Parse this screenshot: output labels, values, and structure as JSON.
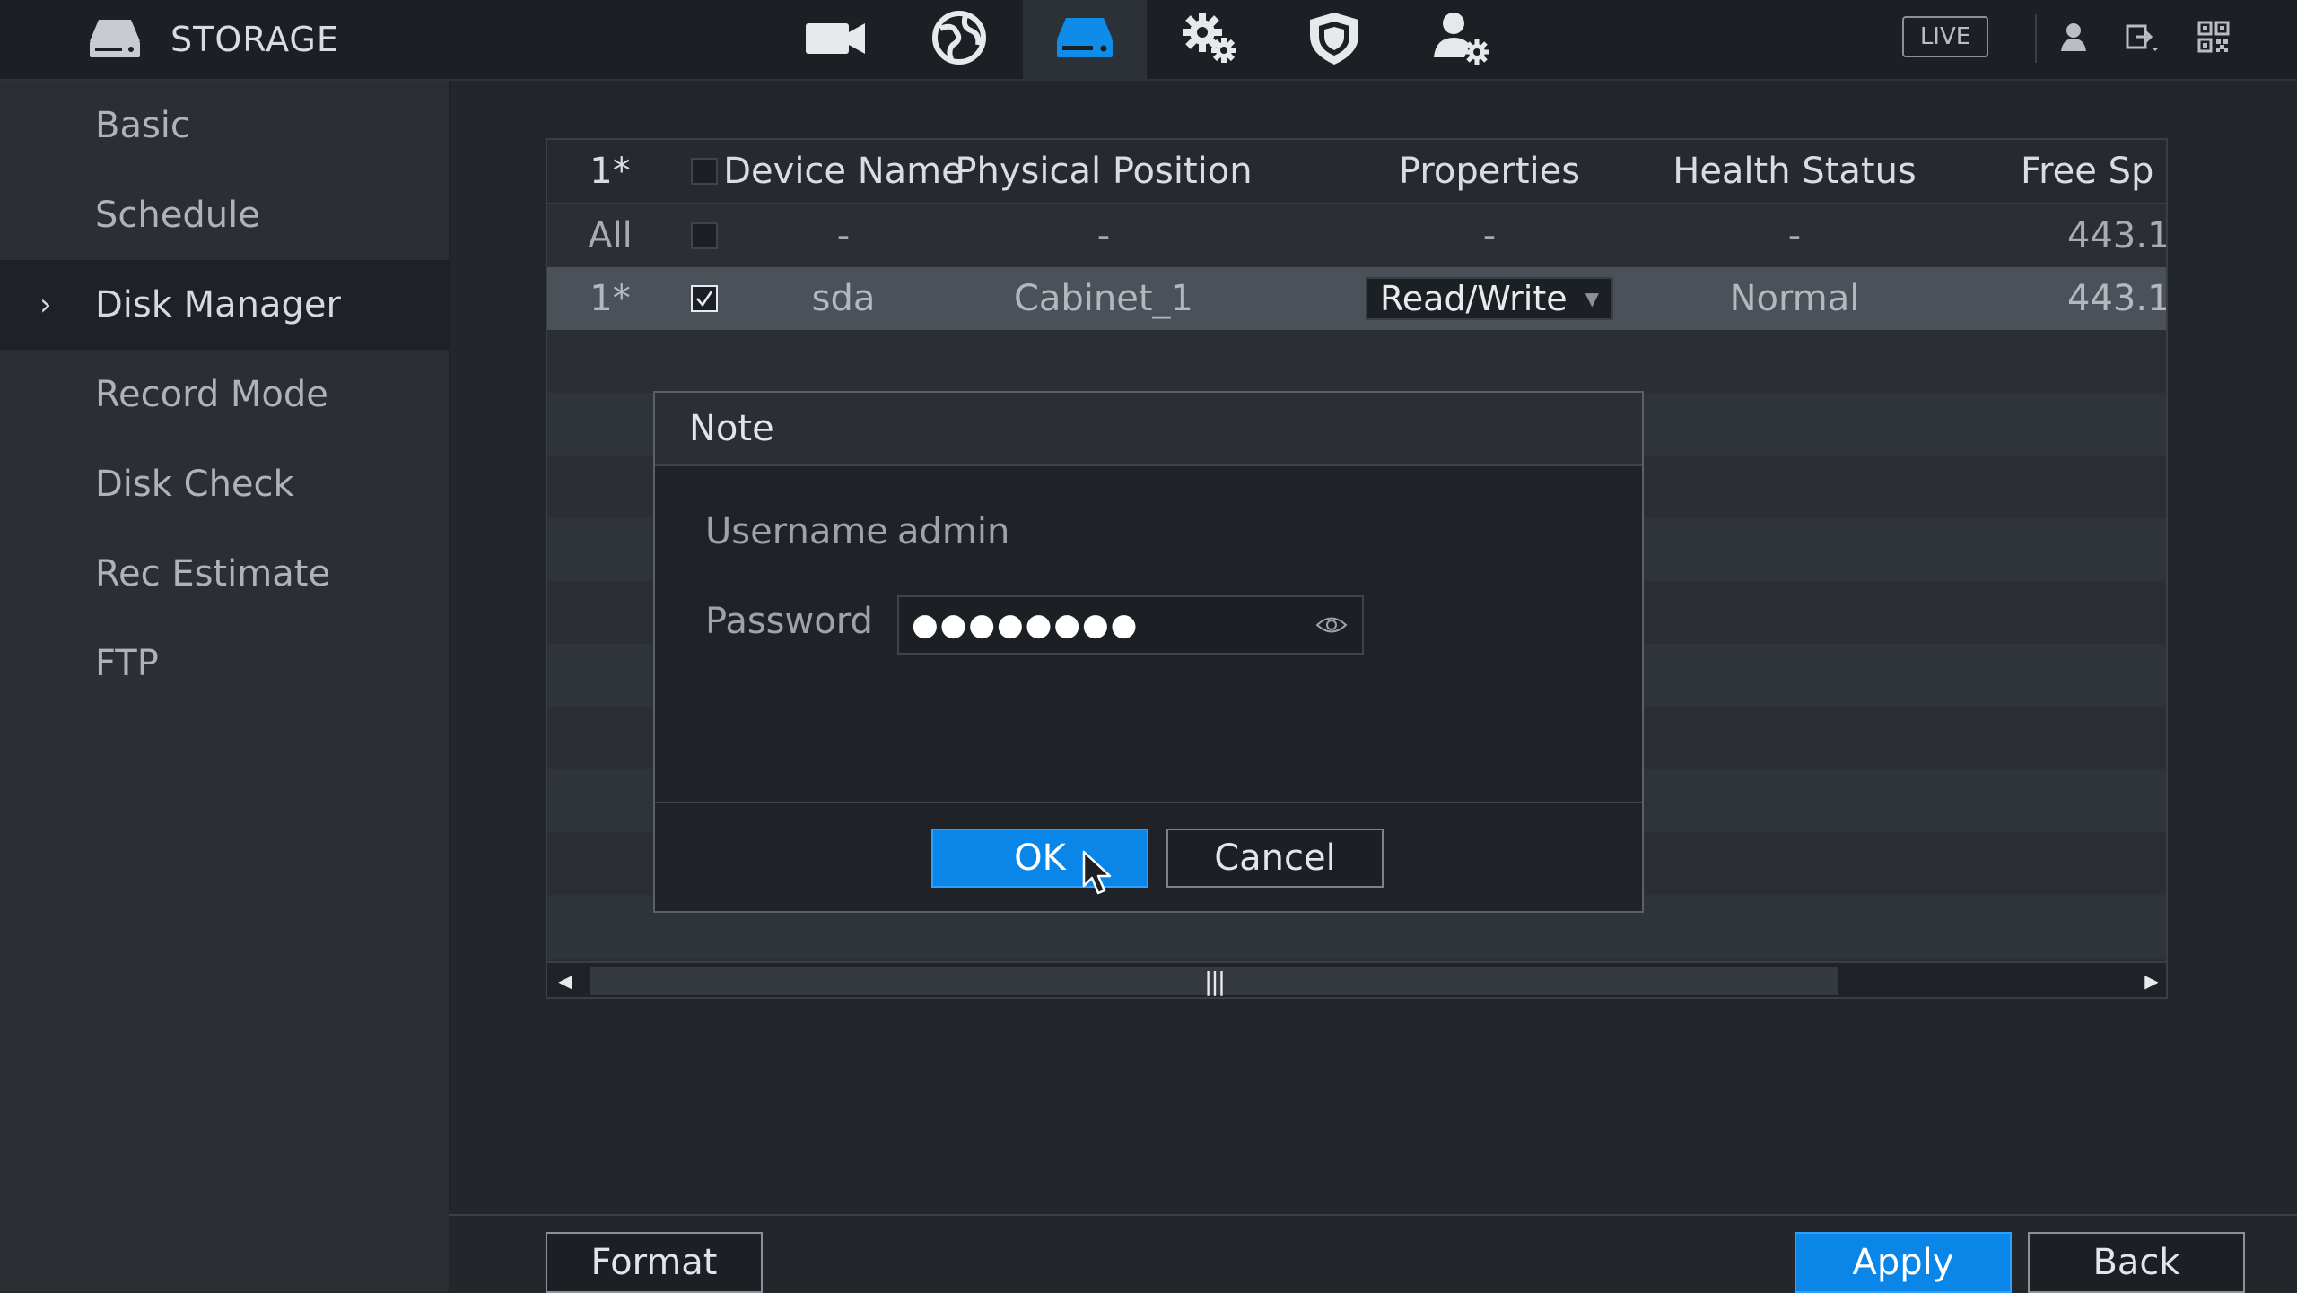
{
  "header": {
    "title": "STORAGE",
    "live_label": "LIVE",
    "nav_icons": [
      "camera-icon",
      "network-globe-icon",
      "storage-drive-icon",
      "system-gears-icon",
      "security-shield-icon",
      "account-gear-icon"
    ],
    "active_nav": "storage-drive-icon",
    "tools": [
      "user-icon",
      "logout-icon",
      "qr-code-icon"
    ]
  },
  "sidebar": {
    "items": [
      {
        "label": "Basic"
      },
      {
        "label": "Schedule"
      },
      {
        "label": "Disk Manager",
        "active": true
      },
      {
        "label": "Record Mode"
      },
      {
        "label": "Disk Check"
      },
      {
        "label": "Rec Estimate"
      },
      {
        "label": "FTP"
      }
    ],
    "active_chevron": "›"
  },
  "table": {
    "headers": [
      "1*",
      "",
      "Device Name",
      "Physical Position",
      "Properties",
      "Health Status",
      "Free Sp"
    ],
    "rows": [
      {
        "no": "All",
        "checked": false,
        "device": "-",
        "position": "-",
        "properties": "-",
        "health": "-",
        "free": "443.1"
      },
      {
        "no": "1*",
        "checked": true,
        "device": "sda",
        "position": "Cabinet_1",
        "properties": "Read/Write",
        "health": "Normal",
        "free": "443.1"
      }
    ],
    "dropdown_arrow": "▼"
  },
  "dialog": {
    "title": "Note",
    "username_label": "Username",
    "username_value": "admin",
    "password_label": "Password",
    "password_mask": "●●●●●●●●",
    "ok_label": "OK",
    "cancel_label": "Cancel"
  },
  "footer": {
    "format_label": "Format",
    "apply_label": "Apply",
    "back_label": "Back"
  },
  "colors": {
    "accent": "#0a86e8",
    "background": "#23272c",
    "panel": "#2b2f34"
  }
}
